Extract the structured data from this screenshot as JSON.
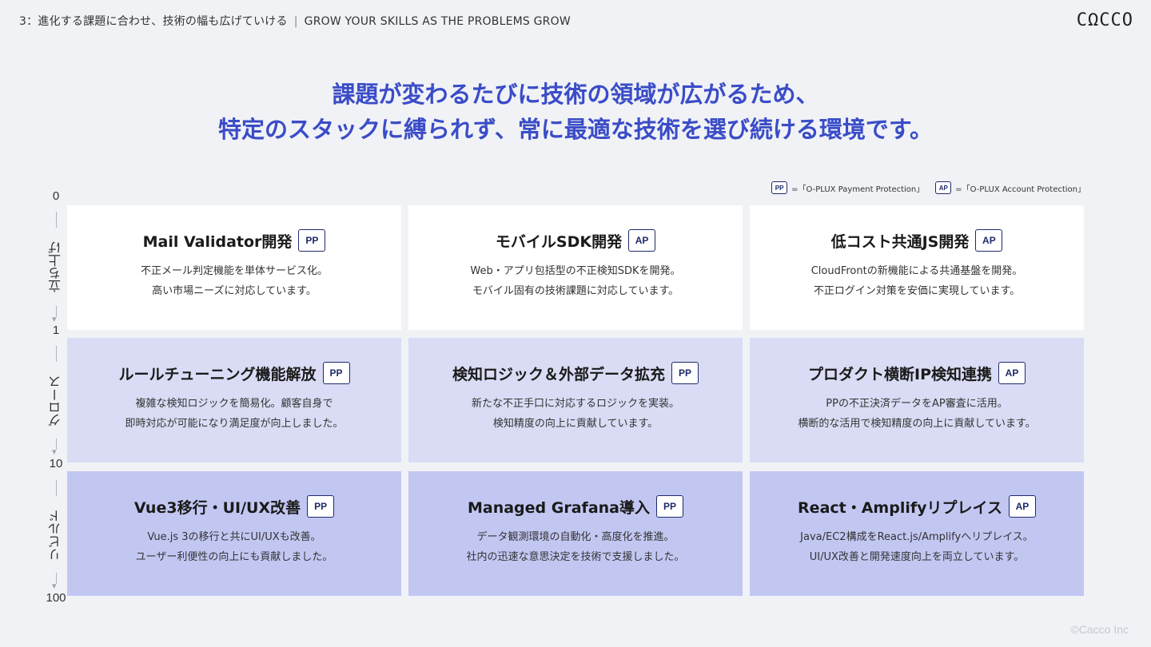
{
  "header": {
    "section": "3：進化する課題に合わせ、技術の幅も広げていける",
    "section_en": "GROW YOUR SKILLS AS THE PROBLEMS GROW",
    "logo": "CΩCCO"
  },
  "headline": {
    "line1": "課題が変わるたびに技術の領域が広がるため、",
    "line2": "特定のスタックに縛られず、常に最適な技術を選び続ける環境です。"
  },
  "legend": [
    {
      "badge": "PP",
      "text": "=「O-PLUX Payment Protection」"
    },
    {
      "badge": "AP",
      "text": "=「O-PLUX Account Protection」"
    }
  ],
  "axis": {
    "ticks": [
      "0",
      "1",
      "10",
      "100"
    ],
    "phases": [
      "立ち上げ",
      "グロース",
      "リビルド"
    ]
  },
  "rows": [
    [
      {
        "title": "Mail Validator開発",
        "badge": "PP",
        "desc1": "不正メール判定機能を単体サービス化。",
        "desc2": "高い市場ニーズに対応しています。"
      },
      {
        "title": "モバイルSDK開発",
        "badge": "AP",
        "desc1": "Web・アプリ包括型の不正検知SDKを開発。",
        "desc2": "モバイル固有の技術課題に対応しています。"
      },
      {
        "title": "低コスト共通JS開発",
        "badge": "AP",
        "desc1": "CloudFrontの新機能による共通基盤を開発。",
        "desc2": "不正ログイン対策を安価に実現しています。"
      }
    ],
    [
      {
        "title": "ルールチューニング機能解放",
        "badge": "PP",
        "desc1": "複雑な検知ロジックを簡易化。顧客自身で",
        "desc2": "即時対応が可能になり満足度が向上しました。"
      },
      {
        "title": "検知ロジック＆外部データ拡充",
        "badge": "PP",
        "desc1": "新たな不正手口に対応するロジックを実装。",
        "desc2": "検知精度の向上に貢献しています。"
      },
      {
        "title": "プロダクト横断IP検知連携",
        "badge": "AP",
        "desc1": "PPの不正決済データをAP審査に活用。",
        "desc2": "横断的な活用で検知精度の向上に貢献しています。"
      }
    ],
    [
      {
        "title": "Vue3移行・UI/UX改善",
        "badge": "PP",
        "desc1": "Vue.js 3の移行と共にUI/UXも改善。",
        "desc2": "ユーザー利便性の向上にも貢献しました。"
      },
      {
        "title": "Managed Grafana導入",
        "badge": "PP",
        "desc1": "データ観測環境の自動化・高度化を推進。",
        "desc2": "社内の迅速な意思決定を技術で支援しました。"
      },
      {
        "title": "React・Amplifyリプレイス",
        "badge": "AP",
        "desc1": "Java/EC2構成をReact.js/Amplifyへリプレイス。",
        "desc2": "UI/UX改善と開発速度向上を両立しています。"
      }
    ]
  ],
  "footer": {
    "copyright": "©Cacco Inc"
  }
}
